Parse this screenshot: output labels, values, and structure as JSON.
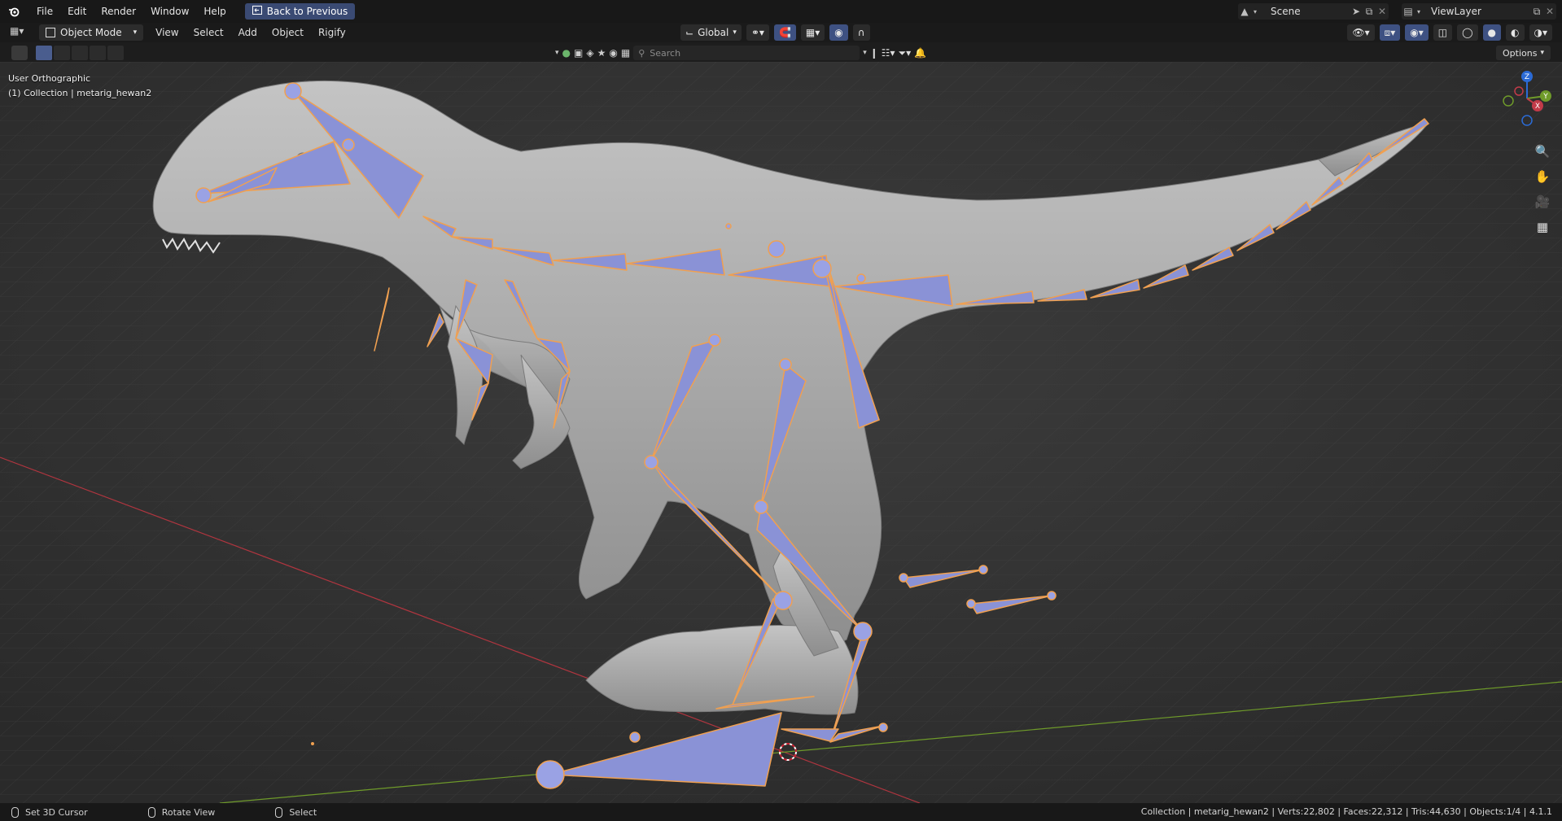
{
  "topbar": {
    "menus": [
      "File",
      "Edit",
      "Render",
      "Window",
      "Help"
    ],
    "back_button": "Back to Previous",
    "scene_name": "Scene",
    "view_layer": "ViewLayer"
  },
  "header": {
    "mode": "Object Mode",
    "menus": [
      "View",
      "Select",
      "Add",
      "Object",
      "Rigify"
    ],
    "transform_orientation": "Global"
  },
  "toolbar": {
    "search_placeholder": "Search",
    "options_label": "Options"
  },
  "viewport": {
    "view_name": "User Orthographic",
    "collection_info": "(1) Collection | metarig_hewan2",
    "gizmo_axes": [
      "Z",
      "Y",
      "X"
    ]
  },
  "statusbar": {
    "hint_cursor": "Set 3D Cursor",
    "hint_rotate": "Rotate View",
    "hint_select": "Select",
    "stats": "Collection | metarig_hewan2 | Verts:22,802 | Faces:22,312 | Tris:44,630 | Objects:1/4 | 4.1.1"
  },
  "colors": {
    "accent": "#3e5182",
    "bone_fill": "#8a92d6",
    "bone_outline": "#f0a050",
    "mesh": "#a8a8a8",
    "axis_x": "#b0353f",
    "axis_y": "#6f9b2a"
  }
}
